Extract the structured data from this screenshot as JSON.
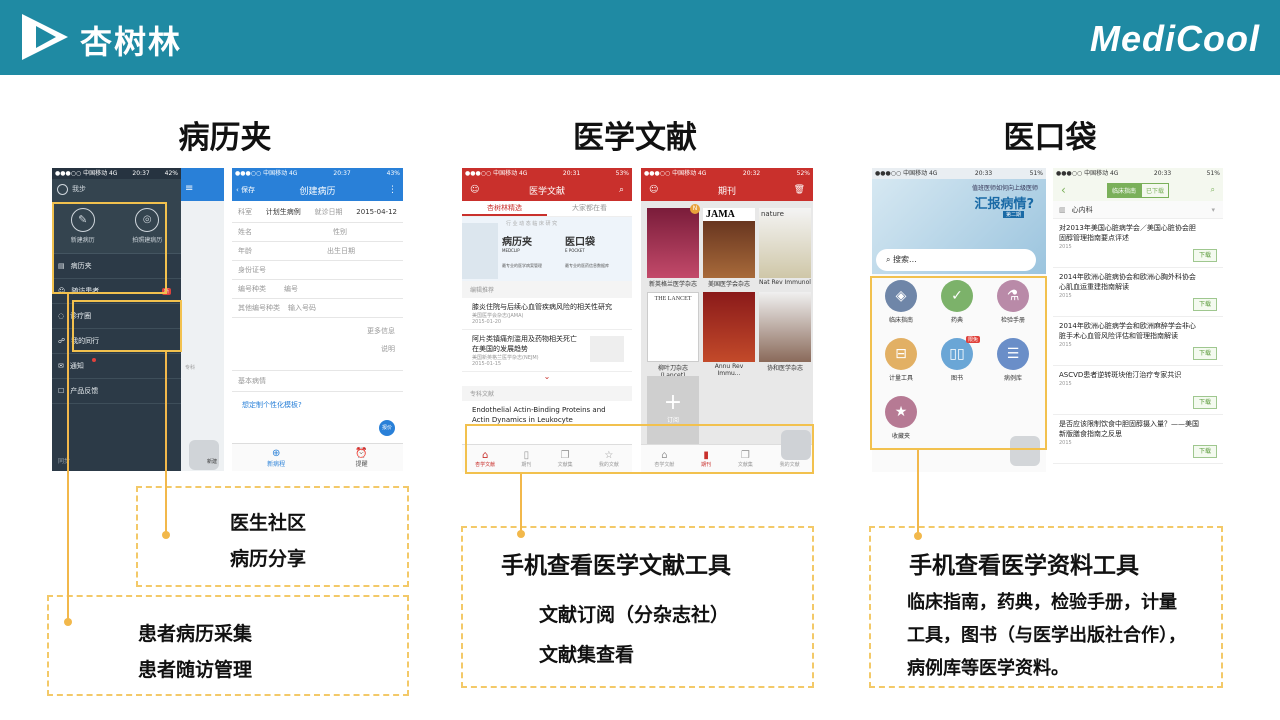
{
  "header": {
    "brand": "杏树林",
    "logo": "MediCool"
  },
  "sections": {
    "s1": "病历夹",
    "s2": "医学文献",
    "s3": "医口袋"
  },
  "s1": {
    "p1": {
      "status_left": "●●●○○ 中国移动 4G",
      "time": "20:37",
      "status_right": "42%",
      "user": "我步",
      "btn1": "新建病历",
      "btn2": "拍照建病历",
      "menu": [
        "病历夹",
        "随访患者",
        "诊疗圈",
        "我的同行",
        "通知",
        "产品反馈"
      ],
      "badge": "新",
      "sync": "同步",
      "right_edge": "新建"
    },
    "p2": {
      "status_left": "●●●○○ 中国移动 4G",
      "time": "20:37",
      "status_right": "43%",
      "back": "保存",
      "title": "创建病历",
      "fields": [
        [
          "科室",
          "计划生病例",
          "就诊日期",
          "2015-04-12"
        ],
        [
          "姓名",
          "",
          "性别",
          ""
        ],
        [
          "年龄",
          "",
          "出生日期",
          ""
        ],
        [
          "身份证号",
          "",
          "",
          ""
        ],
        [
          "编号种类",
          "编号",
          "",
          ""
        ],
        [
          "其他编号种类",
          "输入号码",
          "",
          ""
        ]
      ],
      "more": "更多信息",
      "tips": "说明",
      "basic": "基本病情",
      "link": "想定制个性化模板?",
      "circle": "报价",
      "nav1": "新病程",
      "nav2": "提醒"
    }
  },
  "s2": {
    "p1": {
      "status_left": "●●●○○ 中国移动 4G",
      "time": "20:31",
      "status_right": "53%",
      "title": "医学文献",
      "tab1": "杏树林精选",
      "tab2": "大家都在看",
      "cats": "行 业  动 态  临 床  研 究",
      "app1": "病历夹",
      "app1s": "MEDCLIP",
      "app2": "医口袋",
      "app2s": "E POCKET",
      "sub1": "最专业的医学病案管理",
      "sub2": "最专业的医药信息数据库",
      "sect": "编辑推荐",
      "a1": "膝炎住院与后续心血管疾病风险的相关性研究",
      "a1s": "美国医学会杂志(JAMA)",
      "a1d": "2015-01-20",
      "a2": "阿片类镇痛剂滥用及药物相关死亡在美国的发展趋势",
      "a2s": "美国新英格兰医学杂志(NEJM)",
      "a2d": "2015-01-15",
      "sect2": "专科文献",
      "a3": "Endothelial Actin-Binding Proteins and Actin Dynamics in Leukocyte",
      "nav": [
        "杏学文献",
        "期刊",
        "文献集",
        "我的文献"
      ]
    },
    "p2": {
      "status_left": "●●●○○ 中国移动 4G",
      "time": "20:32",
      "status_right": "52%",
      "title": "期刊",
      "covers": [
        "新英格兰医学杂志",
        "美国医学会杂志",
        "Nat Rev Immunol",
        "柳叶刀杂志(Lancet)",
        "Annu Rev Immu...",
        "协和医学杂志"
      ],
      "jama": "JAMA",
      "nature": "nature",
      "lancet": "THE LANCET",
      "add": "订阅",
      "nav": [
        "杏学文献",
        "期刊",
        "文献集",
        "我的文献"
      ]
    }
  },
  "s3": {
    "p1": {
      "status_left": "●●●○○ 中国移动 4G",
      "time": "20:33",
      "status_right": "51%",
      "banner1": "值班医师如何向上级医师",
      "banner2": "汇报病情?",
      "banner3": "第二期",
      "search": "搜索...",
      "tools": [
        "临床指南",
        "药典",
        "检验手册",
        "计量工具",
        "图书",
        "病例库",
        "收藏夹"
      ],
      "new": "限免"
    },
    "p2": {
      "status_left": "●●●○○ 中国移动 4G",
      "time": "20:33",
      "status_right": "51%",
      "tab1": "临床指南",
      "tab2": "已下载",
      "dept": "心内科",
      "items": [
        [
          "对2013年美国心脏病学会／美国心脏协会胆固醇管理指南要点评述",
          "2015"
        ],
        [
          "2014年欧洲心脏病协会和欧洲心胸外科协会心肌血运重建指南解读",
          "2015"
        ],
        [
          "2014年欧洲心脏病学会和欧洲麻醉学会非心脏手术心血管风险评估和管理指南解读",
          "2015"
        ],
        [
          "ASCVD患者逆转斑块他汀治疗专家共识",
          "2015"
        ],
        [
          "是否应该限制饮食中胆固醇摄入量？——美国新版膳食指南之反思",
          "2015"
        ]
      ],
      "dl": "下载"
    }
  },
  "callouts": {
    "c1": [
      "医生社区",
      "病历分享"
    ],
    "c2": [
      "患者病历采集",
      "患者随访管理"
    ],
    "c3title": "手机查看医学文献工具",
    "c3": [
      "文献订阅（分杂志社）",
      "文献集查看"
    ],
    "c4title": "手机查看医学资料工具",
    "c4": [
      "临床指南，药典，检验手册，计量",
      "工具，图书（与医学出版社合作），",
      "病例库等医学资料。"
    ]
  }
}
